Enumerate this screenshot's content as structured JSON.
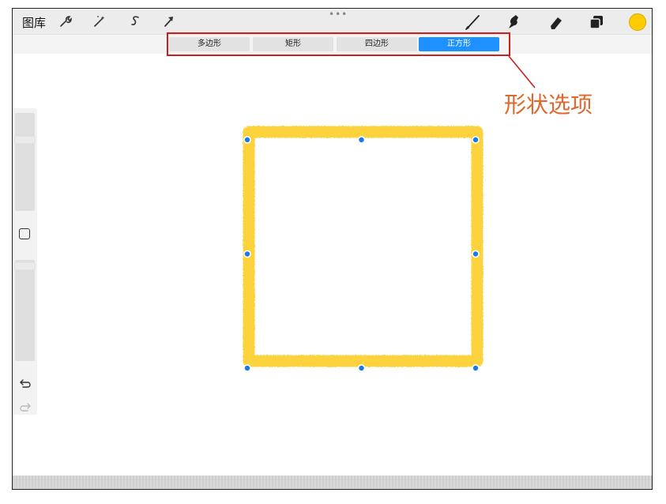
{
  "toolbar": {
    "gallery_label": "图库",
    "left_tools": [
      "wrench-icon",
      "magic-wand-icon",
      "selection-icon",
      "transform-arrow-icon"
    ],
    "drag_handle": "•••",
    "right_tools": [
      "brush-icon",
      "smudge-icon",
      "eraser-icon",
      "layers-icon"
    ],
    "current_color": "#ffcc00"
  },
  "shape_options": {
    "tabs": [
      {
        "label": "多边形",
        "active": false
      },
      {
        "label": "矩形",
        "active": false
      },
      {
        "label": "四边形",
        "active": false
      },
      {
        "label": "正方形",
        "active": true
      }
    ],
    "active_color": "#1e90ff"
  },
  "annotation": {
    "label": "形状选项",
    "color": "#e0672d",
    "highlight_color": "#c8201e"
  },
  "sidebar": {
    "modify_icon": "square-outline-icon",
    "undo_icon": "undo-icon",
    "redo_icon": "redo-icon"
  },
  "canvas": {
    "stroke_color": "#fcd23c",
    "node_color": "#1a7be0",
    "shape": "square"
  }
}
